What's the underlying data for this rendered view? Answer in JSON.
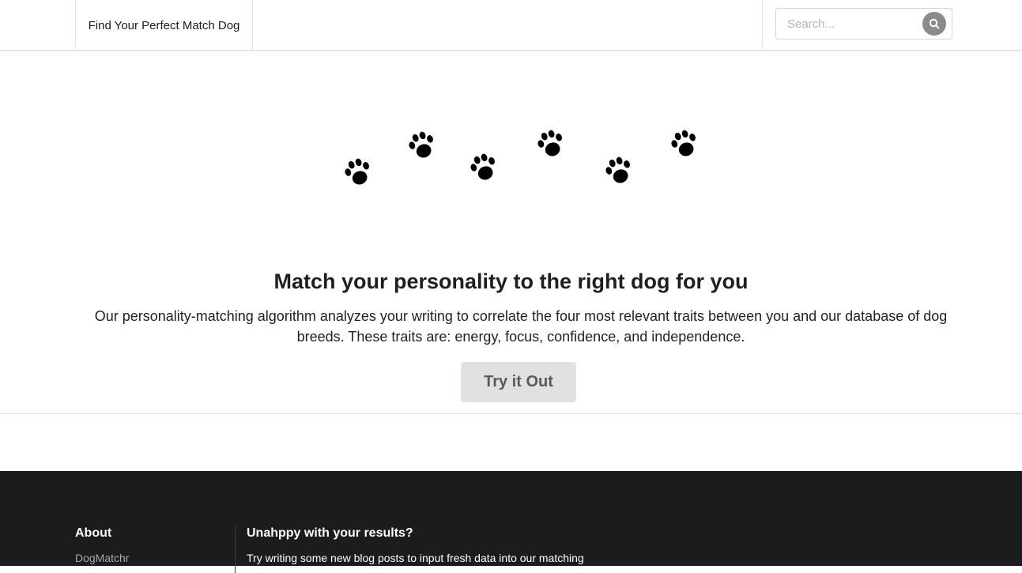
{
  "navbar": {
    "brand_label": "Find Your Perfect Match Dog",
    "search_placeholder": "Search..."
  },
  "icons": {
    "search": "search-icon",
    "paw": "paw-print-icon"
  },
  "hero": {
    "title": "Match your personality to the right dog for you",
    "description": "Our personality-matching algorithm analyzes your writing to correlate the four most relevant traits between you and our database of dog breeds. These traits are: energy, focus, confidence, and independence.",
    "cta_label": "Try it Out"
  },
  "footer": {
    "about_heading": "About",
    "about_link": "DogMatchr",
    "results_heading": "Unahppy with your results?",
    "results_text": "Try writing some new blog posts to input fresh data into our matching"
  },
  "colors": {
    "footer_bg": "#1b1c1d",
    "button_bg": "#e0e1e2",
    "search_button_bg": "#8a8a8a"
  }
}
